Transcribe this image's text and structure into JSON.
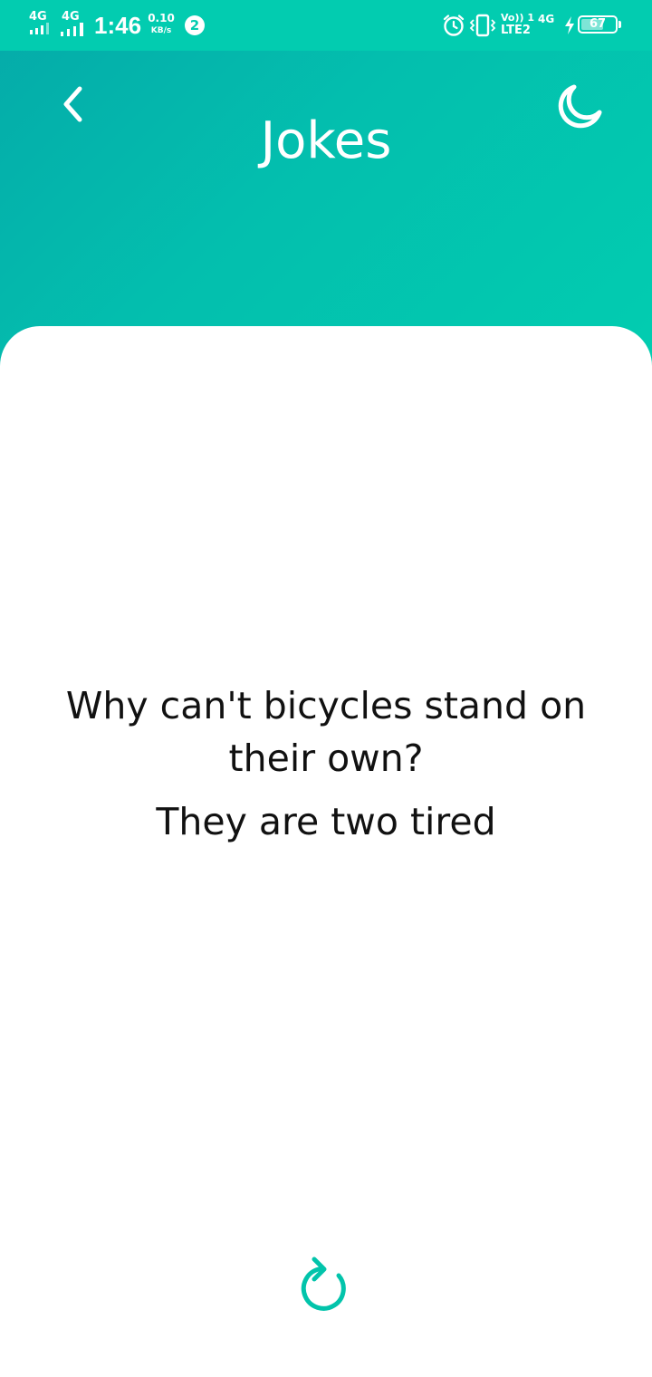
{
  "status_bar": {
    "network1": "4G",
    "network2": "4G",
    "time": "1:46",
    "speed_value": "0.10",
    "speed_unit": "KB/s",
    "notification_count": "2",
    "volte": "Vo)) 1",
    "lte": "LTE2",
    "network3": "4G",
    "battery_level": "67",
    "battery_fraction": 0.67
  },
  "app_bar": {
    "title": "Jokes",
    "back_icon": "chevron-left-icon",
    "theme_icon": "moon-icon"
  },
  "joke": {
    "setup": "Why can't bicycles stand on their own?",
    "punchline": "They are two tired"
  },
  "actions": {
    "refresh_icon": "refresh-icon"
  },
  "colors": {
    "accent": "#02ccb0",
    "header_gradient_start": "#05aaa9",
    "header_gradient_end": "#02cdb0",
    "text": "#111111"
  }
}
